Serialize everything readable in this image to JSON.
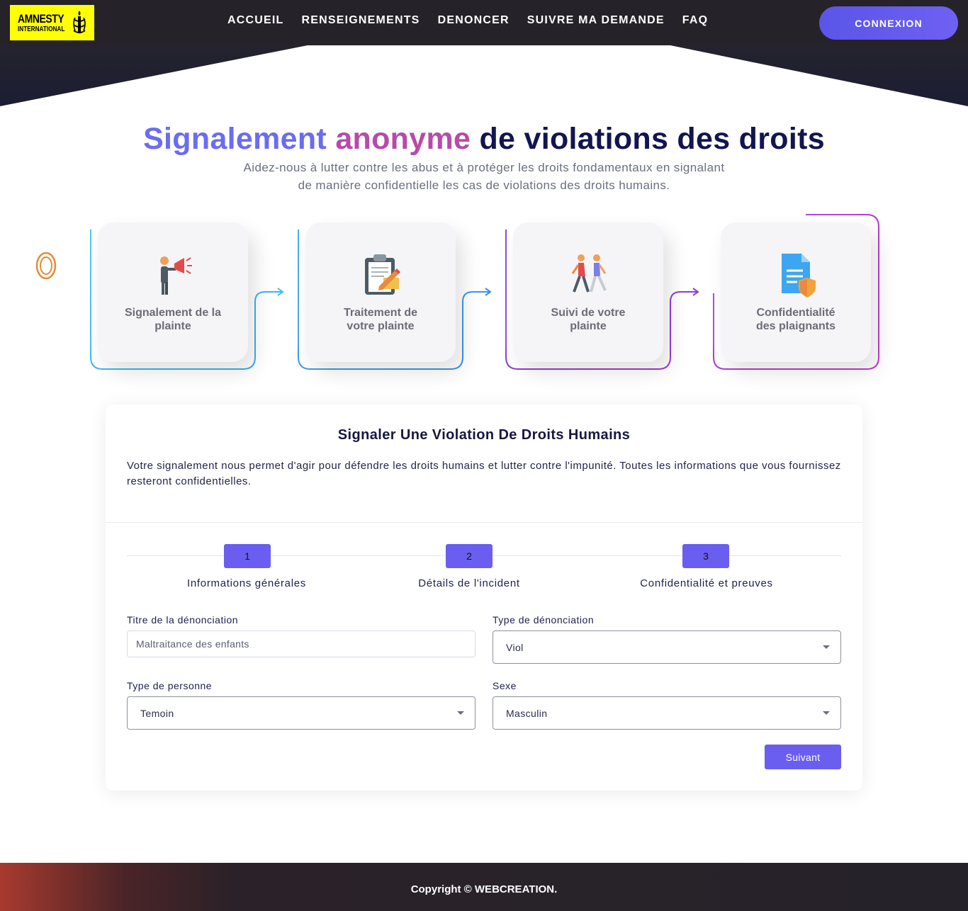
{
  "header": {
    "logo_line1": "AMNESTY",
    "logo_line2": "INTERNATIONAL",
    "nav": [
      "ACCUEIL",
      "RENSEIGNEMENTS",
      "DENONCER",
      "SUIVRE MA DEMANDE",
      "FAQ"
    ],
    "login_label": "CONNEXION"
  },
  "hero": {
    "title_part1": "Signalement",
    "title_part2": "anonyme",
    "title_part3": "de violations des droits",
    "subtitle_line1": "Aidez-nous à lutter contre les abus et à protéger les droits fondamentaux en signalant",
    "subtitle_line2": "de manière confidentielle les cas de violations des droits humains."
  },
  "process": [
    {
      "label_line1": "Signalement de la",
      "label_line2": "plainte",
      "icon": "megaphone-person-icon"
    },
    {
      "label_line1": "Traitement de",
      "label_line2": "votre plainte",
      "icon": "clipboard-pencil-icon"
    },
    {
      "label_line1": "Suivi de votre",
      "label_line2": "plainte",
      "icon": "walking-people-icon"
    },
    {
      "label_line1": "Confidentialité",
      "label_line2": "des plaignants",
      "icon": "document-shield-icon"
    }
  ],
  "form": {
    "title": "Signaler Une Violation De Droits Humains",
    "description": "Votre signalement nous permet d'agir pour défendre les droits humains et lutter contre l'impunité. Toutes les informations que vous fournissez resteront confidentielles.",
    "steps": [
      {
        "number": "1",
        "label": "Informations générales"
      },
      {
        "number": "2",
        "label": "Détails de l'incident"
      },
      {
        "number": "3",
        "label": "Confidentialité et preuves"
      }
    ],
    "titre_label": "Titre de la dénonciation",
    "titre_placeholder": "Maltraitance des enfants",
    "type_denonciation_label": "Type de dénonciation",
    "type_denonciation_value": "Viol",
    "type_personne_label": "Type de personne",
    "type_personne_value": "Temoin",
    "sexe_label": "Sexe",
    "sexe_value": "Masculin",
    "next_label": "Suivant"
  },
  "footer": {
    "copyright": "Copyright © WEBCREATION."
  },
  "colors": {
    "accent": "#6a5ef0",
    "header_bg": "#26222a",
    "logo_bg": "#ffff00"
  }
}
